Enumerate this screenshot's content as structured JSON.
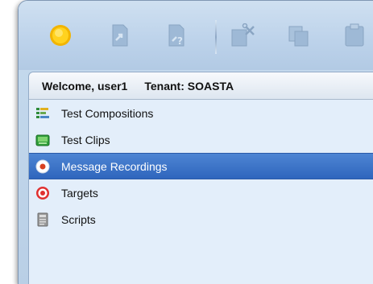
{
  "toolbar": {
    "buttons": [
      {
        "icon": "sun-icon"
      },
      {
        "icon": "export-icon"
      },
      {
        "icon": "help-document-icon"
      },
      {
        "icon": "cut-document-icon"
      },
      {
        "icon": "copy-icon"
      },
      {
        "icon": "paste-icon"
      }
    ]
  },
  "header": {
    "welcome": "Welcome, user1",
    "tenant": "Tenant: SOASTA"
  },
  "nav": {
    "items": [
      {
        "label": "Test Compositions",
        "icon": "compositions-icon"
      },
      {
        "label": "Test Clips",
        "icon": "clip-icon"
      },
      {
        "label": "Message Recordings",
        "icon": "recording-icon",
        "selected": true
      },
      {
        "label": "Targets",
        "icon": "target-icon"
      },
      {
        "label": "Scripts",
        "icon": "script-icon"
      }
    ]
  },
  "colors": {
    "selection": "#3a72c8",
    "panel": "#e3eefa",
    "toolbar": "#c6dbee"
  }
}
